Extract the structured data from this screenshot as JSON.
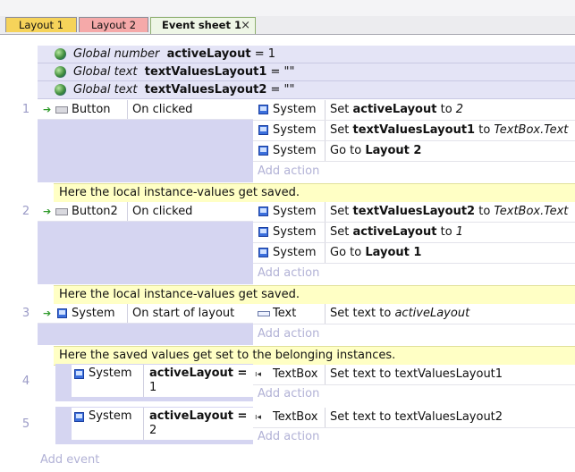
{
  "tabs": [
    {
      "label": "Layout 1"
    },
    {
      "label": "Layout 2"
    },
    {
      "label": "Event sheet 1",
      "close": "×"
    }
  ],
  "globals": [
    {
      "kind": "Global number",
      "name": "activeLayout",
      "rest": " = 1"
    },
    {
      "kind": "Global text",
      "name": "textValuesLayout1",
      "rest": " = \"\""
    },
    {
      "kind": "Global text",
      "name": "textValuesLayout2",
      "rest": " = \"\""
    }
  ],
  "events": {
    "e1": {
      "num": "1",
      "object": "Button",
      "condition": "On clicked"
    },
    "e2": {
      "num": "2",
      "object": "Button2",
      "condition": "On clicked"
    },
    "e3": {
      "num": "3",
      "object": "System",
      "condition": "On start of layout"
    },
    "e4": {
      "num": "4",
      "object": "System",
      "cond_var": "activeLayout =",
      "cond_val": "1"
    },
    "e5": {
      "num": "5",
      "object": "System",
      "cond_var": "activeLayout =",
      "cond_val": "2"
    }
  },
  "actions": {
    "e1": [
      {
        "object": "System",
        "pre": "Set ",
        "bold": "activeLayout",
        "mid": " to ",
        "ital": "2"
      },
      {
        "object": "System",
        "pre": "Set ",
        "bold": "textValuesLayout1",
        "mid": " to ",
        "ital": "TextBox.Text"
      },
      {
        "object": "System",
        "pre": "Go to ",
        "bold": "Layout 2"
      }
    ],
    "e2": [
      {
        "object": "System",
        "pre": "Set ",
        "bold": "textValuesLayout2",
        "mid": " to ",
        "ital": "TextBox.Text"
      },
      {
        "object": "System",
        "pre": "Set ",
        "bold": "activeLayout",
        "mid": " to ",
        "ital": "1"
      },
      {
        "object": "System",
        "pre": "Go to ",
        "bold": "Layout 1"
      }
    ],
    "e3": [
      {
        "object": "Text",
        "pre": "Set text to ",
        "ital": "activeLayout"
      }
    ],
    "e4": [
      {
        "object": "TextBox",
        "pre": "Set text to textValuesLayout1"
      }
    ],
    "e5": [
      {
        "object": "TextBox",
        "pre": "Set text to textValuesLayout2"
      }
    ]
  },
  "comments": [
    "Here the local instance-values get saved.",
    "Here the local instance-values get saved.",
    "Here the saved values get set to the belonging instances."
  ],
  "add_action": "Add action",
  "add_event": "Add event"
}
